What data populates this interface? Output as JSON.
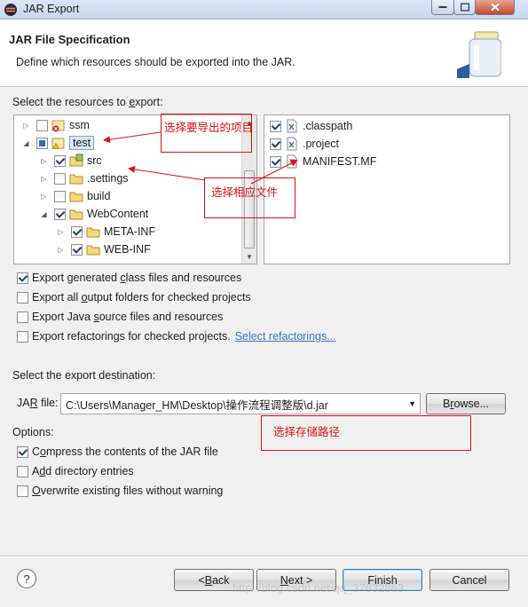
{
  "window": {
    "title": "JAR Export"
  },
  "header": {
    "title": "JAR File Specification",
    "description": "Define which resources should be exported into the JAR."
  },
  "resources": {
    "label_pre": "Select the resources to ",
    "label_mnemonic": "e",
    "label_post": "xport:",
    "tree": [
      {
        "name": "ssm",
        "checked": false,
        "icon": "project-error-icon"
      },
      {
        "name": "test",
        "checked": "partial",
        "icon": "project-warning-icon",
        "selected": true
      },
      {
        "name": "src",
        "checked": true,
        "icon": "source-folder-icon"
      },
      {
        "name": ".settings",
        "checked": false,
        "icon": "folder-icon"
      },
      {
        "name": "build",
        "checked": false,
        "icon": "folder-icon"
      },
      {
        "name": "WebContent",
        "checked": true,
        "icon": "folder-icon"
      },
      {
        "name": "META-INF",
        "checked": true,
        "icon": "folder-icon"
      },
      {
        "name": "WEB-INF",
        "checked": true,
        "icon": "folder-icon"
      }
    ],
    "files": [
      {
        "name": ".classpath",
        "checked": true,
        "icon": "xml-file-icon"
      },
      {
        "name": ".project",
        "checked": true,
        "icon": "xml-file-icon"
      },
      {
        "name": "MANIFEST.MF",
        "checked": true,
        "icon": "text-file-icon"
      }
    ]
  },
  "export_options": [
    {
      "pre": "Export generated ",
      "m": "c",
      "post": "lass files and resources",
      "checked": true
    },
    {
      "pre": "Export all ",
      "m": "o",
      "post": "utput folders for checked projects",
      "checked": false
    },
    {
      "pre": "Export Java ",
      "m": "s",
      "post": "ource files and resources",
      "checked": false
    },
    {
      "pre": "Export refactorings for checked projects. ",
      "m": "",
      "post": "",
      "checked": false
    }
  ],
  "refactorings_link": "Select refactorings...",
  "destination": {
    "label": "Select the export destination:",
    "jar_label_pre": "JA",
    "jar_label_m": "R",
    "jar_label_post": " file:",
    "jar_path": "C:\\Users\\Manager_HM\\Desktop\\操作流程调整版\\d.jar",
    "browse_pre": "B",
    "browse_m": "r",
    "browse_post": "owse..."
  },
  "options": {
    "label": "Options:",
    "items": [
      {
        "pre": "C",
        "m": "o",
        "post": "mpress the contents of the JAR file",
        "checked": true
      },
      {
        "pre": "A",
        "m": "d",
        "post": "d directory entries",
        "checked": false
      },
      {
        "pre": "",
        "m": "O",
        "post": "verwrite existing files without warning",
        "checked": false
      }
    ]
  },
  "buttons": {
    "help": "?",
    "back_pre": "< ",
    "back_m": "B",
    "back_post": "ack",
    "next_m": "N",
    "next_post": "ext >",
    "finish": "Finish",
    "cancel": "Cancel"
  },
  "annotations": {
    "project": "选择要导出的项目",
    "files": "选择相应文件",
    "storage": "选择存储路径"
  },
  "watermark": "http://blog.csdn.net/qq_37832863",
  "colors": {
    "annotation": "#e01010",
    "link": "#3b74c6"
  }
}
